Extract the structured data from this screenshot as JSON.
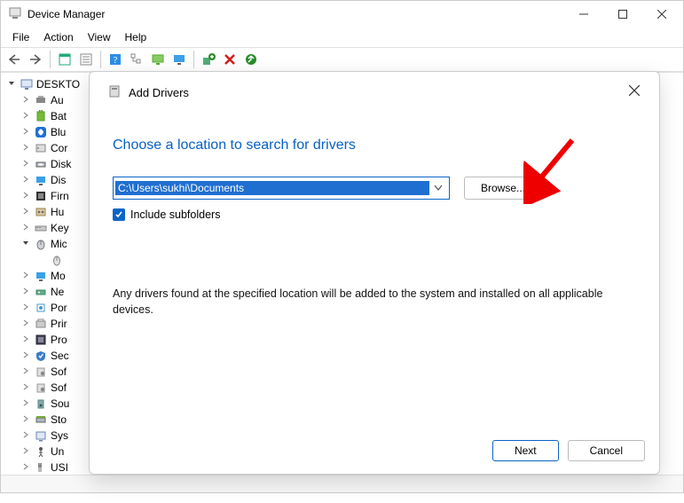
{
  "window": {
    "title": "Device Manager"
  },
  "menu": {
    "file": "File",
    "action": "Action",
    "view": "View",
    "help": "Help"
  },
  "tree": {
    "root": "DESKTO",
    "items": [
      {
        "label": "Au"
      },
      {
        "label": "Bat"
      },
      {
        "label": "Blu"
      },
      {
        "label": "Cor"
      },
      {
        "label": "Disk"
      },
      {
        "label": "Dis"
      },
      {
        "label": "Firn"
      },
      {
        "label": "Hu"
      },
      {
        "label": "Key"
      },
      {
        "label": "Mic",
        "expanded": true
      },
      {
        "label": "Mo"
      },
      {
        "label": "Ne"
      },
      {
        "label": "Por"
      },
      {
        "label": "Prir"
      },
      {
        "label": "Pro"
      },
      {
        "label": "Sec"
      },
      {
        "label": "Sof"
      },
      {
        "label": "Sof"
      },
      {
        "label": "Sou"
      },
      {
        "label": "Sto"
      },
      {
        "label": "Sys"
      },
      {
        "label": "Un"
      },
      {
        "label": "USI"
      }
    ]
  },
  "dialog": {
    "title": "Add Drivers",
    "heading": "Choose a location to search for drivers",
    "path": "C:\\Users\\sukhi\\Documents",
    "browse": "Browse...",
    "include_label": "Include subfolders",
    "include_checked": true,
    "info": "Any drivers found at the specified location will be added to the system and installed on all applicable devices.",
    "next": "Next",
    "cancel": "Cancel"
  }
}
